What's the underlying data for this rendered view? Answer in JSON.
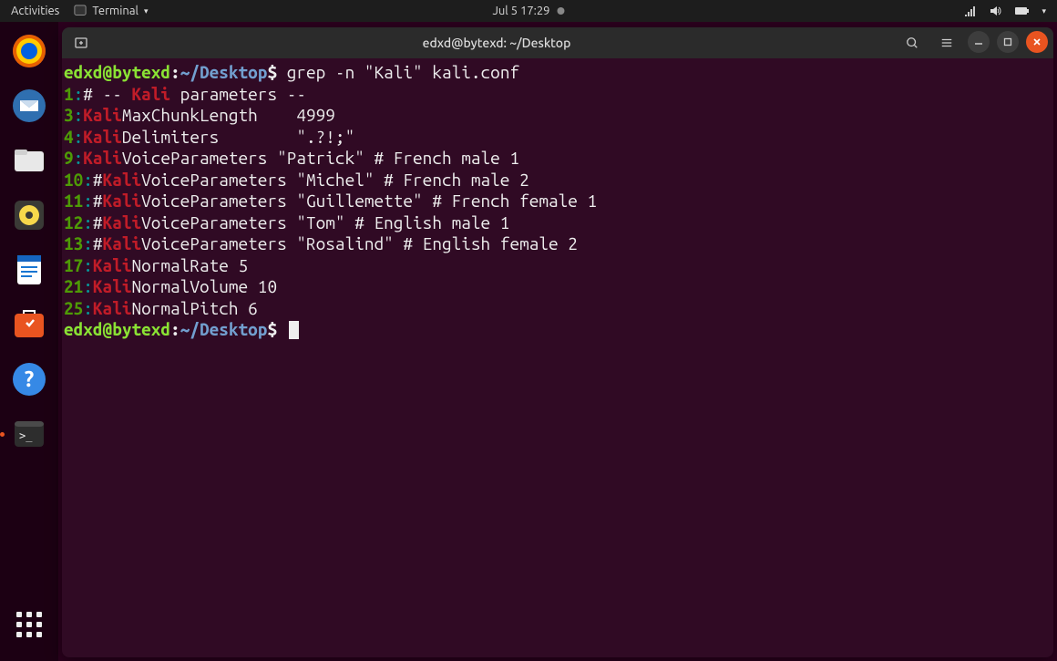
{
  "topbar": {
    "activities": "Activities",
    "app_menu": "Terminal",
    "date": "Jul 5  17:29"
  },
  "dock": {
    "items": [
      "firefox-icon",
      "thunderbird-icon",
      "files-icon",
      "rhythmbox-icon",
      "writer-icon",
      "software-icon",
      "help-icon",
      "terminal-icon"
    ]
  },
  "window": {
    "title": "edxd@bytexd: ~/Desktop"
  },
  "terminal": {
    "prompt": {
      "user": "edxd@bytexd",
      "path": "~/Desktop",
      "symbol": "$"
    },
    "command": "grep -n \"Kali\" kali.conf",
    "output": [
      {
        "n": "1",
        "pre": "# -- ",
        "m": "Kali",
        "post": " parameters --"
      },
      {
        "n": "3",
        "pre": "",
        "m": "Kali",
        "post": "MaxChunkLength    4999"
      },
      {
        "n": "4",
        "pre": "",
        "m": "Kali",
        "post": "Delimiters        \".?!;\""
      },
      {
        "n": "9",
        "pre": "",
        "m": "Kali",
        "post": "VoiceParameters \"Patrick\" # French male 1"
      },
      {
        "n": "10",
        "pre": "#",
        "m": "Kali",
        "post": "VoiceParameters \"Michel\" # French male 2"
      },
      {
        "n": "11",
        "pre": "#",
        "m": "Kali",
        "post": "VoiceParameters \"Guillemette\" # French female 1"
      },
      {
        "n": "12",
        "pre": "#",
        "m": "Kali",
        "post": "VoiceParameters \"Tom\" # English male 1"
      },
      {
        "n": "13",
        "pre": "#",
        "m": "Kali",
        "post": "VoiceParameters \"Rosalind\" # English female 2"
      },
      {
        "n": "17",
        "pre": "",
        "m": "Kali",
        "post": "NormalRate 5"
      },
      {
        "n": "21",
        "pre": "",
        "m": "Kali",
        "post": "NormalVolume 10"
      },
      {
        "n": "25",
        "pre": "",
        "m": "Kali",
        "post": "NormalPitch 6"
      }
    ]
  }
}
